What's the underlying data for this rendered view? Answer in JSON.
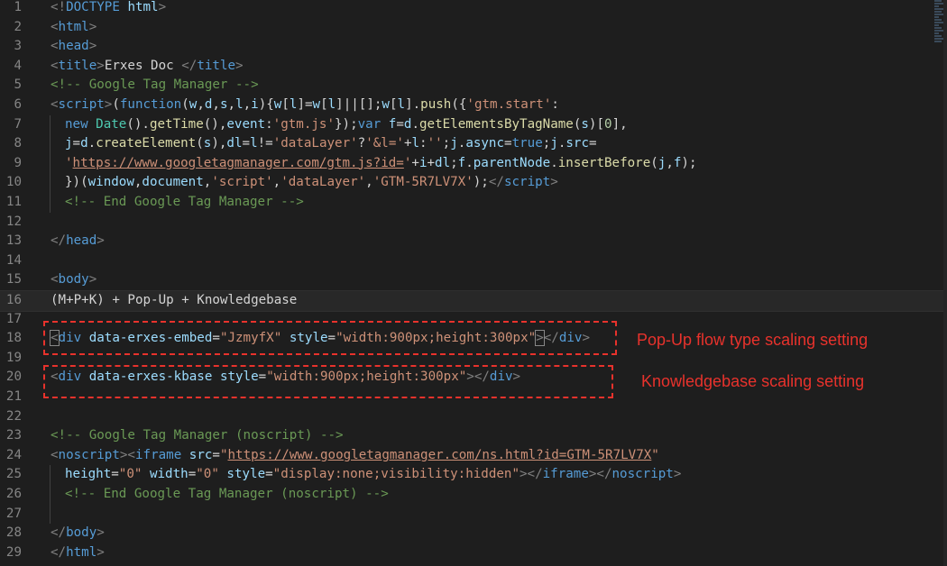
{
  "editor": {
    "line_numbers": [
      "1",
      "2",
      "3",
      "4",
      "5",
      "6",
      "7",
      "8",
      "9",
      "10",
      "11",
      "12",
      "13",
      "14",
      "15",
      "16",
      "17",
      "18",
      "19",
      "20",
      "21",
      "22",
      "23",
      "24",
      "25",
      "26",
      "27",
      "28",
      "29"
    ],
    "lines": {
      "l1": [
        "<!",
        "DOCTYPE",
        " ",
        "html",
        ">"
      ],
      "l2": [
        "<",
        "html",
        ">"
      ],
      "l3": [
        "<",
        "head",
        ">"
      ],
      "l4": [
        "<",
        "title",
        ">",
        "Erxes Doc ",
        "</",
        "title",
        ">"
      ],
      "l5": [
        "<!-- Google Tag Manager -->"
      ],
      "l6": [
        "<",
        "script",
        ">",
        "(",
        "function",
        "(",
        "w",
        ",",
        "d",
        ",",
        "s",
        ",",
        "l",
        ",",
        "i",
        ")",
        "{",
        "w",
        "[",
        "l",
        "]=",
        "w",
        "[",
        "l",
        "]||[];",
        "w",
        "[",
        "l",
        "].",
        "push",
        "({",
        "'gtm.start'",
        ":"
      ],
      "l7": [
        "new",
        " ",
        "Date",
        "().",
        "getTime",
        "(),",
        "event",
        ":",
        "'gtm.js'",
        "});",
        "var",
        " ",
        "f",
        "=",
        "d",
        ".",
        "getElementsByTagName",
        "(",
        "s",
        ")[",
        "0",
        "],"
      ],
      "l8": [
        "j",
        "=",
        "d",
        ".",
        "createElement",
        "(",
        "s",
        "),",
        "dl",
        "=",
        "l",
        "!=",
        "'dataLayer'",
        "?",
        "'&l='",
        "+",
        "l",
        ":",
        "''",
        ";",
        "j",
        ".",
        "async",
        "=",
        "true",
        ";",
        "j",
        ".",
        "src",
        "="
      ],
      "l9": [
        "'",
        "https://www.googletagmanager.com/gtm.js?id=",
        "'",
        "+",
        "i",
        "+",
        "dl",
        ";",
        "f",
        ".",
        "parentNode",
        ".",
        "insertBefore",
        "(",
        "j",
        ",",
        "f",
        ");"
      ],
      "l10": [
        "})(",
        "window",
        ",",
        "document",
        ",",
        "'script'",
        ",",
        "'dataLayer'",
        ",",
        "'GTM-5R7LV7X'",
        ");",
        "</",
        "script",
        ">"
      ],
      "l11": [
        "<!-- End Google Tag Manager -->"
      ],
      "l13": [
        "</",
        "head",
        ">"
      ],
      "l15": [
        "<",
        "body",
        ">"
      ],
      "l16": [
        "(M+P+K) + Pop-Up + Knowledgebase"
      ],
      "l18": [
        "<",
        "div",
        " ",
        "data-erxes-embed",
        "=",
        "\"JzmyfX\"",
        " ",
        "style",
        "=",
        "\"width:900px;height:300px\"",
        ">",
        "</",
        "div",
        ">"
      ],
      "l20": [
        "<",
        "div",
        " ",
        "data-erxes-kbase",
        " ",
        "style",
        "=",
        "\"width:900px;height:300px\"",
        "></",
        "div",
        ">"
      ],
      "l23": [
        "<!-- Google Tag Manager (noscript) -->"
      ],
      "l24": [
        "<",
        "noscript",
        "><",
        "iframe",
        " ",
        "src",
        "=",
        "\"",
        "https://www.googletagmanager.com/ns.html?id=GTM-5R7LV7X",
        "\""
      ],
      "l25": [
        "height",
        "=",
        "\"0\"",
        " ",
        "width",
        "=",
        "\"0\"",
        " ",
        "style",
        "=",
        "\"display:none;visibility:hidden\"",
        "></",
        "iframe",
        "></",
        "noscript",
        ">"
      ],
      "l26": [
        "<!-- End Google Tag Manager (noscript) -->"
      ],
      "l28": [
        "</",
        "body",
        ">"
      ],
      "l29": [
        "</",
        "html",
        ">"
      ]
    }
  },
  "annotations": {
    "popup_label": "Pop-Up flow type scaling setting",
    "kbase_label": "Knowledgebase scaling setting",
    "color": "#e8322c"
  },
  "theme": {
    "background": "#1e1e1e",
    "tag_color": "#569cd6",
    "attribute_color": "#9cdcfe",
    "string_color": "#ce9178",
    "comment_color": "#6a9955",
    "function_color": "#dcdcaa"
  }
}
